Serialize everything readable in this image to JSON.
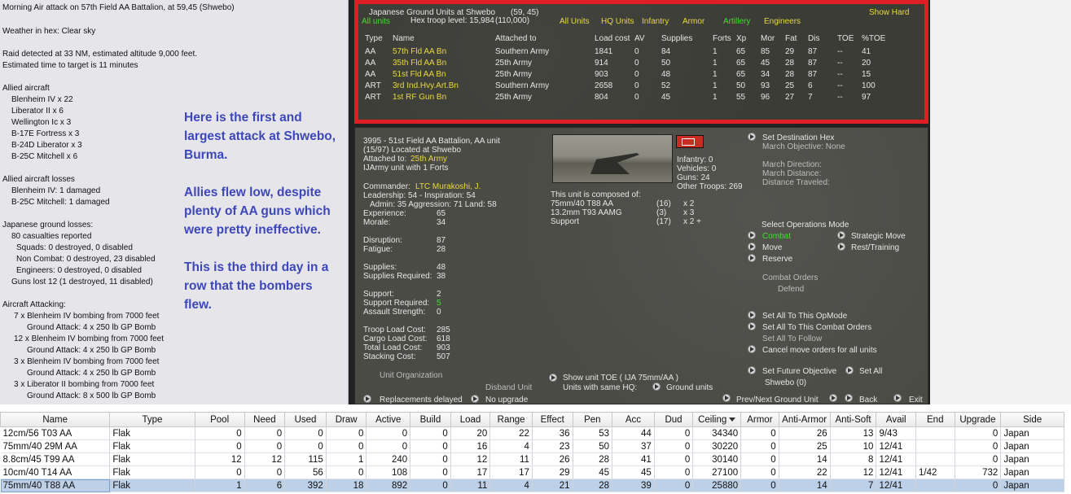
{
  "report": {
    "lines": [
      "Morning Air attack on 57th Field AA Battalion, at 59,45 (Shwebo)",
      "Weather in hex: Clear sky",
      "Raid detected at 33 NM, estimated altitude 9,000 feet.",
      "Estimated time to target is 11 minutes",
      "Allied aircraft",
      "Blenheim IV x 22",
      "Liberator II x 6",
      "Wellington Ic x 3",
      "B-17E Fortress x 3",
      "B-24D Liberator x 3",
      "B-25C Mitchell x 6",
      "Allied aircraft losses",
      "Blenheim IV: 1 damaged",
      "B-25C Mitchell: 1 damaged",
      "Japanese ground losses:",
      "80 casualties reported",
      "Squads: 0 destroyed, 0 disabled",
      "Non Combat: 0 destroyed, 23 disabled",
      "Engineers: 0 destroyed, 0 disabled",
      "Guns lost 12 (1 destroyed, 11 disabled)",
      "Aircraft Attacking:",
      "7 x Blenheim IV bombing from 7000 feet",
      "Ground Attack:  4 x 250 lb GP Bomb",
      "12 x Blenheim IV bombing from 7000 feet",
      "Ground Attack:  4 x 250 lb GP Bomb",
      "3 x Blenheim IV bombing from 7000 feet",
      "Ground Attack:  4 x 250 lb GP Bomb",
      "3 x Liberator II bombing from 7000 feet",
      "Ground Attack:  8 x 500 lb GP Bomb"
    ],
    "commentary": [
      "Here is the first and largest attack at Shwebo, Burma.",
      "Allies flew low, despite plenty of AA guns which were pretty ineffective.",
      "This is the third day in a row that the bombers flew."
    ]
  },
  "ground": {
    "title": "Japanese Ground Units at Shwebo",
    "coords": "(59, 45)",
    "troop_level": "Hex troop level: 15,984",
    "troop_level_max": "(110,000)",
    "show_hard": "Show Hard",
    "filters": [
      "All units",
      "All Units",
      "HQ Units",
      "Infantry",
      "Armor",
      "Artillery",
      "Engineers"
    ],
    "headers": [
      "Type",
      "Name",
      "Attached to",
      "Load cost",
      "AV",
      "Supplies",
      "Forts",
      "Xp",
      "Mor",
      "Fat",
      "Dis",
      "TOE",
      "%TOE"
    ],
    "rows": [
      [
        "AA",
        "57th Fld AA Bn",
        "Southern Army",
        "1841",
        "0",
        "84",
        "1",
        "65",
        "85",
        "29",
        "87",
        "--",
        "41"
      ],
      [
        "AA",
        "35th Fld AA Bn",
        "25th Army",
        "914",
        "0",
        "50",
        "1",
        "65",
        "45",
        "28",
        "87",
        "--",
        "20"
      ],
      [
        "AA",
        "51st Fld AA Bn",
        "25th Army",
        "903",
        "0",
        "48",
        "1",
        "65",
        "34",
        "28",
        "87",
        "--",
        "15"
      ],
      [
        "ART",
        "3rd Ind.Hvy.Art.Bn",
        "Southern Army",
        "2658",
        "0",
        "52",
        "1",
        "50",
        "93",
        "25",
        "6",
        "--",
        "100"
      ],
      [
        "ART",
        "1st RF Gun Bn",
        "25th Army",
        "804",
        "0",
        "45",
        "1",
        "55",
        "96",
        "27",
        "7",
        "--",
        "97"
      ]
    ]
  },
  "unit": {
    "header": "3995 - 51st Field AA Battalion, AA unit",
    "located": "(15/97) Located at Shwebo",
    "attached_label": "Attached to:",
    "attached_value": "25th Army",
    "army_unit": "IJArmy unit with 1 Forts",
    "commander_label": "Commander:",
    "commander_value": "LTC Murakoshi, J.",
    "leadership": "Leadership: 54 - Inspiration: 54",
    "admin": "Admin: 35  Aggression: 71  Land: 58",
    "stats1": [
      [
        "Experience:",
        "65"
      ],
      [
        "Morale:",
        "34"
      ]
    ],
    "stats2": [
      [
        "Disruption:",
        "87"
      ],
      [
        "Fatigue:",
        "28"
      ]
    ],
    "stats3": [
      [
        "Supplies:",
        "48"
      ],
      [
        "Supplies Required:",
        "38"
      ]
    ],
    "stats4": [
      [
        "Support:",
        "2"
      ],
      [
        "Support Required:",
        "5"
      ],
      [
        "Assault Strength:",
        "0"
      ]
    ],
    "stats5": [
      [
        "Troop Load Cost:",
        "285"
      ],
      [
        "Cargo Load Cost:",
        "618"
      ],
      [
        "Total Load Cost:",
        "903"
      ],
      [
        "Stacking Cost:",
        "507"
      ]
    ],
    "composition_title": "This unit is composed of:",
    "composition": [
      [
        "75mm/40 T88 AA",
        "(16)",
        "x 2"
      ],
      [
        "13.2mm T93 AAMG",
        "(3)",
        "x 3"
      ],
      [
        "Support",
        "(17)",
        "x 2 +"
      ]
    ],
    "counts": [
      "Infantry: 0",
      "Vehicles: 0",
      "Guns: 24",
      "Other Troops: 269"
    ],
    "set_destination": "Set Destination Hex",
    "march_objective": "March Objective: None",
    "march_direction": "March Direction:",
    "march_distance": "March Distance:",
    "distance_traveled": "Distance Traveled:",
    "ops_mode_title": "Select Operations Mode",
    "ops_modes": [
      "Combat",
      "Move",
      "Reserve",
      "Strategic Move",
      "Rest/Training"
    ],
    "combat_orders": "Combat Orders",
    "defend": "Defend",
    "set_all_opmode": "Set All To This OpMode",
    "set_all_combat": "Set All To This Combat Orders",
    "set_all_follow": "Set All To Follow",
    "cancel_move": "Cancel move orders for all units",
    "set_future": "Set Future Objective",
    "set_all": "Set All",
    "future_value": "Shwebo (0)",
    "unit_org": "Unit Organization",
    "show_toe": "Show unit TOE ( IJA 75mm/AA )",
    "same_hq": "Units with same HQ:",
    "ground_units": "Ground units",
    "disband": "Disband Unit",
    "no_upgrade": "No upgrade",
    "replacements": "Replacements delayed",
    "prev_next": "Prev/Next Ground Unit",
    "back": "Back",
    "exit": "Exit"
  },
  "device_table": {
    "headers": [
      "Name",
      "Type",
      "Pool",
      "Need",
      "Used",
      "Draw",
      "Active",
      "Build",
      "Load",
      "Range",
      "Effect",
      "Pen",
      "Acc",
      "Dud",
      "Ceiling",
      "Armor",
      "Anti-Armor",
      "Anti-Soft",
      "Avail",
      "End",
      "Upgrade",
      "Side"
    ],
    "rows": [
      [
        "12cm/56 T03 AA",
        "Flak",
        "0",
        "0",
        "0",
        "0",
        "0",
        "0",
        "20",
        "22",
        "36",
        "53",
        "44",
        "0",
        "34340",
        "0",
        "26",
        "13",
        "9/43",
        "",
        "0",
        "Japan"
      ],
      [
        "75mm/40 29M AA",
        "Flak",
        "0",
        "0",
        "0",
        "0",
        "0",
        "0",
        "16",
        "4",
        "23",
        "50",
        "37",
        "0",
        "30220",
        "0",
        "25",
        "10",
        "12/41",
        "",
        "0",
        "Japan"
      ],
      [
        "8.8cm/45 T99 AA",
        "Flak",
        "12",
        "12",
        "115",
        "1",
        "240",
        "0",
        "12",
        "11",
        "26",
        "28",
        "41",
        "0",
        "30140",
        "0",
        "14",
        "8",
        "12/41",
        "",
        "0",
        "Japan"
      ],
      [
        "10cm/40 T14 AA",
        "Flak",
        "0",
        "0",
        "56",
        "0",
        "108",
        "0",
        "17",
        "17",
        "29",
        "45",
        "45",
        "0",
        "27100",
        "0",
        "22",
        "12",
        "12/41",
        "1/42",
        "732",
        "Japan"
      ],
      [
        "75mm/40 T88 AA",
        "Flak",
        "1",
        "6",
        "392",
        "18",
        "892",
        "0",
        "11",
        "4",
        "21",
        "28",
        "39",
        "0",
        "25880",
        "0",
        "14",
        "7",
        "12/41",
        "",
        "0",
        "Japan"
      ]
    ]
  },
  "colors": {
    "highlight_red": "#e01e25",
    "unit_yellow": "#e8d840",
    "active_green": "#44dd33",
    "commentary_blue": "#3d47b8",
    "selected_row": "#bdd0e8"
  }
}
